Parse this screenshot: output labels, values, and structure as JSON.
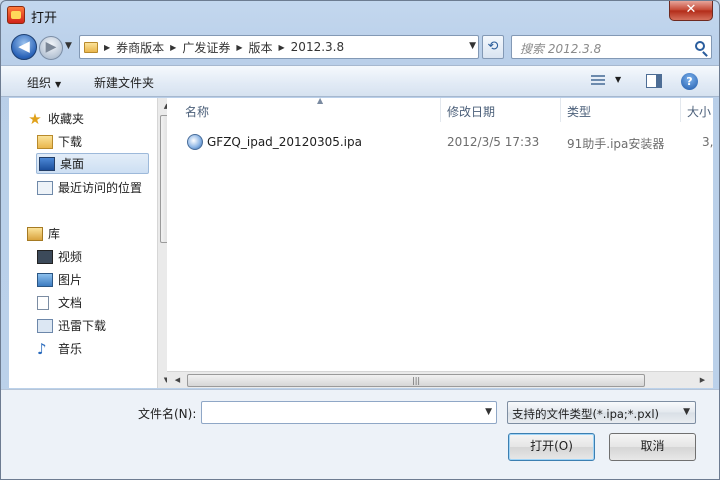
{
  "window": {
    "title": "打开",
    "close_glyph": "✕"
  },
  "nav": {
    "breadcrumbs": [
      "券商版本",
      "广发证券",
      "版本",
      "2012.3.8"
    ],
    "search_placeholder": "搜索 2012.3.8"
  },
  "toolbar": {
    "organize_label": "组织",
    "new_folder_label": "新建文件夹"
  },
  "sidebar": {
    "favorites_label": "收藏夹",
    "favorites": [
      {
        "label": "下载",
        "icon": "download-folder-icon"
      },
      {
        "label": "桌面",
        "icon": "desktop-icon",
        "selected": true
      },
      {
        "label": "最近访问的位置",
        "icon": "recent-places-icon"
      }
    ],
    "libraries_label": "库",
    "libraries": [
      {
        "label": "视频",
        "icon": "video-icon"
      },
      {
        "label": "图片",
        "icon": "pictures-icon"
      },
      {
        "label": "文档",
        "icon": "documents-icon"
      },
      {
        "label": "迅雷下载",
        "icon": "xunlei-download-icon"
      },
      {
        "label": "音乐",
        "icon": "music-icon"
      }
    ]
  },
  "file_list": {
    "columns": [
      "名称",
      "修改日期",
      "类型",
      "大小"
    ],
    "rows": [
      {
        "name": "GFZQ_ipad_20120305.ipa",
        "modified": "2012/3/5 17:33",
        "type": "91助手.ipa安装器",
        "size": "3,"
      }
    ]
  },
  "bottom": {
    "filename_label": "文件名(N):",
    "filename_value": "",
    "filter_value": "支持的文件类型(*.ipa;*.pxl)",
    "open_label": "打开(O)",
    "cancel_label": "取消"
  }
}
